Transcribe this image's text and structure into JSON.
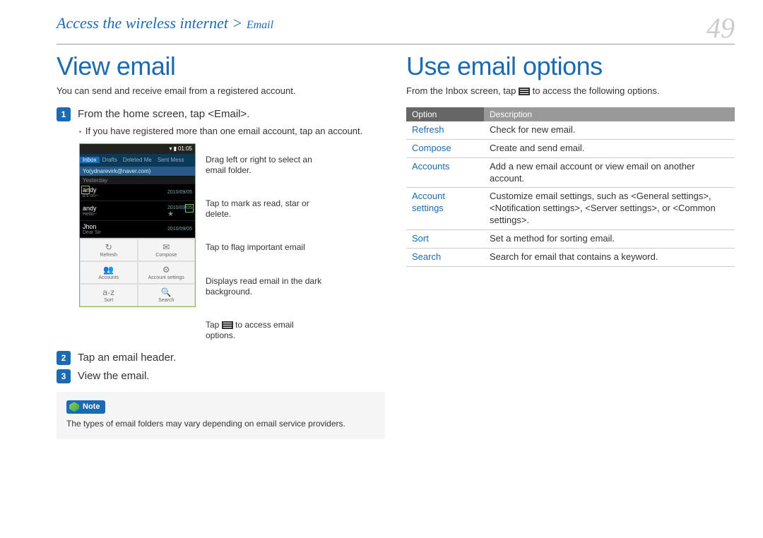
{
  "header": {
    "breadcrumb_main": "Access the wireless internet >",
    "breadcrumb_sub": "Email",
    "page_number": "49"
  },
  "left": {
    "title": "View email",
    "intro": "You can send and receive email from a registered account.",
    "steps": [
      "From the home screen, tap <Email>.",
      "Tap an email header.",
      "View the email."
    ],
    "sub_bullet": "If you have registered more than one email account, tap an account.",
    "callouts": {
      "c1": "Drag left or right to select an email folder.",
      "c2": "Tap to mark as read, star or delete.",
      "c3": "Tap to flag important email",
      "c4": "Displays read email in the dark background.",
      "c5a": "Tap ",
      "c5b": " to access email options."
    },
    "phone": {
      "time": "01:05",
      "tabs": [
        "Inbox",
        "Drafts",
        "Deleted Me",
        "Sent Mess"
      ],
      "address": "Yo(ydnarevirk@naver.com)",
      "section1": "Yesterday",
      "rows": [
        {
          "name": "andy",
          "date": "2010/09/05",
          "sub": "it's on~"
        },
        {
          "name": "andy",
          "date": "2010/09/05",
          "sub": "Hello~"
        },
        {
          "name": "Jhon",
          "date": "2010/09/05",
          "sub": "Dear Sir"
        }
      ],
      "options": [
        {
          "icon": "↻",
          "label": "Refresh"
        },
        {
          "icon": "✉",
          "label": "Compose"
        },
        {
          "icon": "👥",
          "label": "Accounts"
        },
        {
          "icon": "⚙",
          "label": "Account settings"
        },
        {
          "icon": "a-z",
          "label": "Sort"
        },
        {
          "icon": "🔍",
          "label": "Search"
        }
      ]
    },
    "note": {
      "label": "Note",
      "text": "The types of email folders may vary depending on email service providers."
    }
  },
  "right": {
    "title": "Use email options",
    "intro_a": "From the Inbox screen, tap ",
    "intro_b": " to access the following options.",
    "table_headers": [
      "Option",
      "Description"
    ],
    "rows": [
      {
        "opt": "Refresh",
        "desc": "Check for new email."
      },
      {
        "opt": "Compose",
        "desc": "Create and send email."
      },
      {
        "opt": "Accounts",
        "desc": "Add a new email account or view email on another account."
      },
      {
        "opt": "Account settings",
        "desc": "Customize email settings, such as <General settings>, <Notification settings>, <Server settings>, or <Common settings>."
      },
      {
        "opt": "Sort",
        "desc": "Set a method for sorting email."
      },
      {
        "opt": "Search",
        "desc": "Search for email that contains a keyword."
      }
    ]
  }
}
